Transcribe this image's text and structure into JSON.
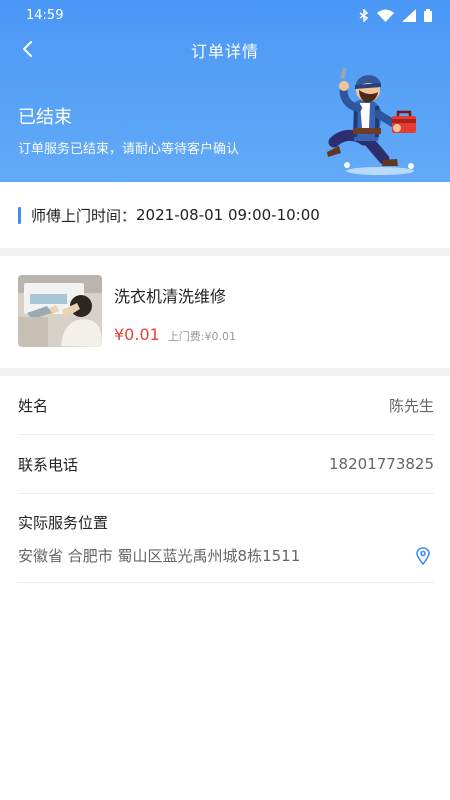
{
  "status_bar": {
    "time": "14:59",
    "icons": [
      "bluetooth-icon",
      "wifi-icon",
      "signal-icon",
      "battery-icon"
    ]
  },
  "nav": {
    "back_icon": "chevron-left-icon",
    "title": "订单详情"
  },
  "order_status": {
    "title": "已结束",
    "description": "订单服务已结束，请耐心等待客户确认",
    "illustration": "repairman-illustration"
  },
  "visit_time": {
    "label": "师傅上门时间：",
    "value": "2021-08-01 09:00-10:00"
  },
  "product": {
    "name": "洗衣机清洗维修",
    "price": "¥0.01",
    "visit_fee_label": "上门费:",
    "visit_fee_value": "¥0.01"
  },
  "customer": {
    "name_label": "姓名",
    "name_value": "陈先生",
    "phone_label": "联系电话",
    "phone_value": "18201773825",
    "address_label": "实际服务位置",
    "address_value": "安徽省 合肥市 蜀山区蓝光禹州城8栋1511",
    "address_icon": "location-pin-icon"
  },
  "colors": {
    "header_gradient_start": "#4a97f6",
    "header_gradient_end": "#63abf7",
    "accent": "#3e8ef6",
    "price": "#e2443b"
  }
}
